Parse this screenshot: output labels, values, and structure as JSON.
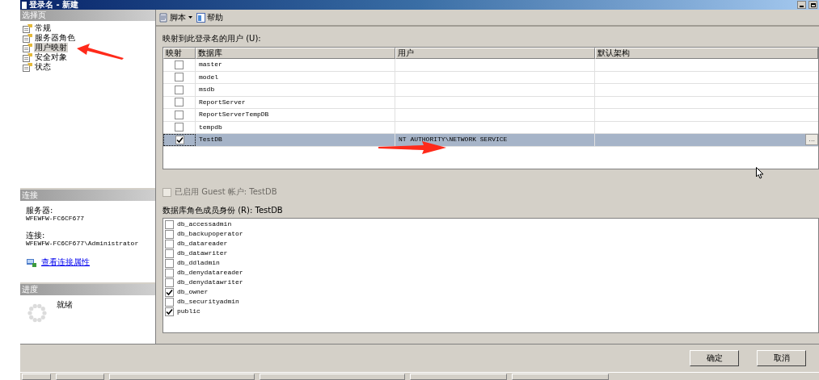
{
  "window": {
    "title": "登录名 - 新建"
  },
  "select_page": {
    "header": "选择页",
    "items": [
      {
        "label": "常规",
        "selected": false
      },
      {
        "label": "服务器角色",
        "selected": false
      },
      {
        "label": "用户映射",
        "selected": true
      },
      {
        "label": "安全对象",
        "selected": false
      },
      {
        "label": "状态",
        "selected": false
      }
    ]
  },
  "connection": {
    "header": "连接",
    "server_label": "服务器:",
    "server": "WFEWFW-FC6CF677",
    "connection_label": "连接:",
    "connection": "WFEWFW-FC6CF677\\Administrator",
    "link": "查看连接属性"
  },
  "progress": {
    "header": "进度",
    "status": "就绪"
  },
  "toolbar": {
    "script": "脚本",
    "help": "帮助"
  },
  "mapping": {
    "label": "映射到此登录名的用户 (U):",
    "columns": [
      "映射",
      "数据库",
      "用户",
      "默认架构"
    ],
    "rows": [
      {
        "checked": false,
        "selected": false,
        "database": "master"
      },
      {
        "checked": false,
        "selected": false,
        "database": "model"
      },
      {
        "checked": false,
        "selected": false,
        "database": "msdb"
      },
      {
        "checked": false,
        "selected": false,
        "database": "ReportServer"
      },
      {
        "checked": false,
        "selected": false,
        "database": "ReportServerTempDB"
      },
      {
        "checked": false,
        "selected": false,
        "database": "tempdb"
      },
      {
        "checked": true,
        "selected": true,
        "database": "TestDB",
        "user": "NT AUTHORITY\\NETWORK SERVICE",
        "browse": "..."
      }
    ]
  },
  "guest": {
    "label": "已启用 Guest 帐户: TestDB",
    "checked": false,
    "disabled": true
  },
  "roles": {
    "label": "数据库角色成员身份 (R): TestDB",
    "items": [
      {
        "name": "db_accessadmin",
        "checked": false
      },
      {
        "name": "db_backupoperator",
        "checked": false
      },
      {
        "name": "db_datareader",
        "checked": false
      },
      {
        "name": "db_datawriter",
        "checked": false
      },
      {
        "name": "db_ddladmin",
        "checked": false
      },
      {
        "name": "db_denydatareader",
        "checked": false
      },
      {
        "name": "db_denydatawriter",
        "checked": false
      },
      {
        "name": "db_owner",
        "checked": true
      },
      {
        "name": "db_securityadmin",
        "checked": false
      },
      {
        "name": "public",
        "checked": true
      }
    ]
  },
  "buttons": [
    "确定",
    "取消"
  ]
}
